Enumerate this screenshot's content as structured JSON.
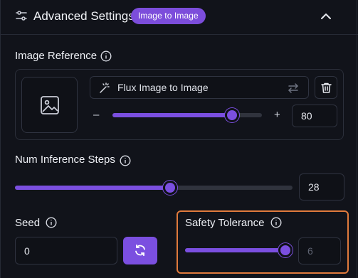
{
  "header": {
    "title": "Advanced Settings",
    "badge": "Image to Image"
  },
  "image_reference": {
    "label": "Image Reference",
    "model_name": "Flux Image to Image",
    "strength": {
      "value": "80",
      "min_symbol": "–",
      "max_symbol": "+",
      "fraction": 0.8
    }
  },
  "inference_steps": {
    "label": "Num Inference Steps",
    "value": "28",
    "fraction": 0.56
  },
  "seed": {
    "label": "Seed",
    "value": "0"
  },
  "safety_tolerance": {
    "label": "Safety Tolerance",
    "value": "6",
    "fraction": 1.0
  },
  "colors": {
    "accent": "#7b4fe0",
    "highlight_border": "#e07a3c"
  }
}
